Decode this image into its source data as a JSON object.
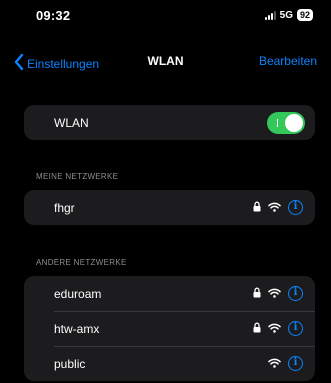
{
  "status_bar": {
    "time": "09:32",
    "network": "5G",
    "battery": "92"
  },
  "nav": {
    "back_label": "Einstellungen",
    "title": "WLAN",
    "edit_label": "Bearbeiten"
  },
  "wlan_toggle": {
    "label": "WLAN",
    "on": true
  },
  "my_networks": {
    "header": "MEINE NETZWERKE",
    "items": [
      {
        "name": "fhgr",
        "locked": true
      }
    ]
  },
  "other_networks": {
    "header": "ANDERE NETZWERKE",
    "items": [
      {
        "name": "eduroam",
        "locked": true
      },
      {
        "name": "htw-amx",
        "locked": true
      },
      {
        "name": "public",
        "locked": false
      }
    ]
  },
  "colors": {
    "accent": "#0a84ff",
    "toggle_on": "#34c759",
    "card_bg": "#1c1c1e",
    "background": "#000000"
  }
}
